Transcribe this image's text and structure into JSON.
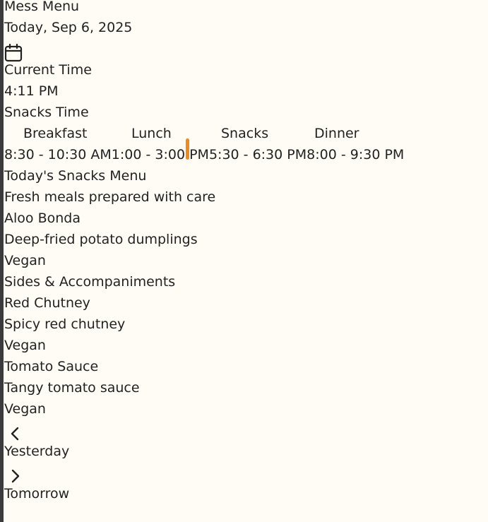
{
  "header": {
    "title": "Mess Menu",
    "date": "Today, Sep 6, 2025",
    "calendar_icon": "calendar-icon"
  },
  "clock": {
    "label": "Current Time",
    "time": "4:11 PM",
    "current_meal": "Snacks Time"
  },
  "meals": {
    "names": [
      "Breakfast",
      "Lunch",
      "Snacks",
      "Dinner"
    ],
    "times": [
      "8:30 - 10:30 AM",
      "1:00 - 3:00 PM",
      "5:30 - 6:30 PM",
      "8:00 - 9:30 PM"
    ],
    "accent_color": "#f08a1c"
  },
  "menu": {
    "title": "Today's Snacks Menu",
    "subtitle": "Fresh meals prepared with care",
    "main": {
      "name": "Aloo Bonda",
      "description": "Deep-fried potato dumplings",
      "tag": "Vegan"
    },
    "sides_title": "Sides & Accompaniments",
    "sides": [
      {
        "name": "Red Chutney",
        "description": "Spicy red chutney",
        "tag": "Vegan"
      },
      {
        "name": "Tomato Sauce",
        "description": "Tangy tomato sauce",
        "tag": "Vegan"
      }
    ]
  },
  "nav": {
    "prev_label": "Yesterday",
    "prev_icon": "chevron-left-icon",
    "next_label": "Tomorrow",
    "next_icon": "chevron-right-icon"
  },
  "colors": {
    "background": "#fffcf5",
    "left_bar": "#3b3b3b"
  }
}
